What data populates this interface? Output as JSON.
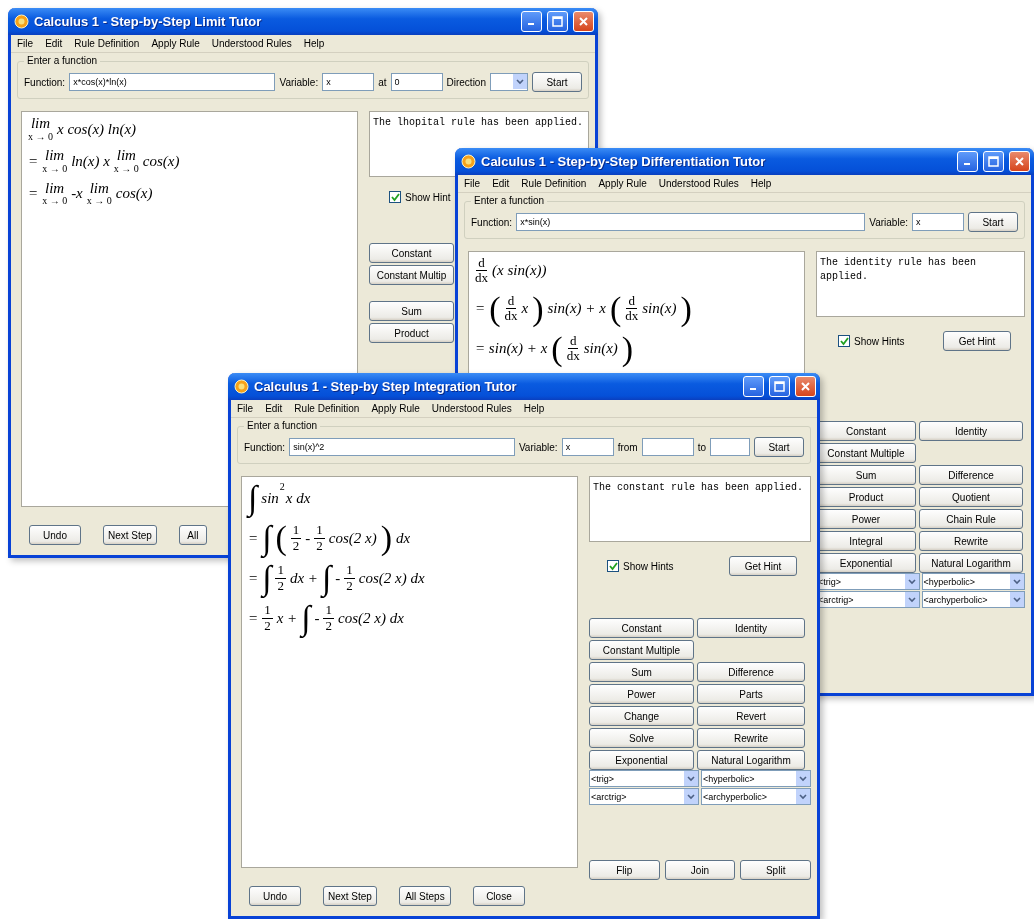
{
  "windows": [
    {
      "title": "Calculus 1 - Step-by-Step Limit Tutor",
      "menu": [
        "File",
        "Edit",
        "Rule Definition",
        "Apply Rule",
        "Understood Rules",
        "Help"
      ],
      "group_label": "Enter a function",
      "fields": [
        {
          "label": "Function:",
          "value": "x*cos(x)*ln(x)",
          "kind": "text"
        },
        {
          "label": "Variable:",
          "value": "x",
          "kind": "text"
        },
        {
          "label": "at",
          "value": "0",
          "kind": "text"
        },
        {
          "label": "Direction",
          "kind": "select"
        }
      ],
      "start": "Start",
      "math": [
        [
          {
            "kind": "lim",
            "word": "lim",
            "under": "x → 0"
          },
          {
            "kind": "text",
            "text": "x cos(x) ln(x)"
          }
        ],
        [
          {
            "kind": "text",
            "text": "="
          },
          {
            "kind": "lim",
            "word": "lim",
            "under": "x → 0"
          },
          {
            "kind": "text",
            "text": "ln(x) x"
          },
          {
            "kind": "lim",
            "word": "lim",
            "under": "x → 0"
          },
          {
            "kind": "text",
            "text": "cos(x)"
          }
        ],
        [
          {
            "kind": "text",
            "text": "="
          },
          {
            "kind": "lim",
            "word": "lim",
            "under": "x → 0"
          },
          {
            "kind": "text",
            "text": "-x"
          },
          {
            "kind": "lim",
            "word": "lim",
            "under": "x → 0"
          },
          {
            "kind": "text",
            "text": "cos(x)"
          }
        ]
      ],
      "hint": "The lhopital rule has been applied.",
      "show_hints": {
        "label": "Show Hint",
        "checked": true
      },
      "rule_groups": [
        [
          [
            "Constant"
          ],
          [
            "Constant Multip"
          ]
        ],
        [
          [
            "Sum"
          ],
          [
            "Product"
          ]
        ]
      ],
      "bottom_buttons": [
        "Undo",
        "Next Step",
        "All"
      ]
    },
    {
      "title": "Calculus 1 - Step-by-Step Differentiation Tutor",
      "menu": [
        "File",
        "Edit",
        "Rule Definition",
        "Apply Rule",
        "Understood Rules",
        "Help"
      ],
      "group_label": "Enter a function",
      "fields": [
        {
          "label": "Function:",
          "value": "x*sin(x)",
          "kind": "text"
        },
        {
          "label": "Variable:",
          "value": "x",
          "kind": "text"
        }
      ],
      "start": "Start",
      "math": [
        [
          {
            "kind": "frac",
            "num": "d",
            "den": "dx"
          },
          {
            "kind": "text",
            "text": "(x sin(x))"
          }
        ],
        [
          {
            "kind": "text",
            "text": "="
          },
          {
            "kind": "big",
            "text": "("
          },
          {
            "kind": "frac",
            "num": "d",
            "den": "dx"
          },
          {
            "kind": "text",
            "text": "x"
          },
          {
            "kind": "big",
            "text": ")"
          },
          {
            "kind": "text",
            "text": "sin(x) + x"
          },
          {
            "kind": "big",
            "text": "("
          },
          {
            "kind": "frac",
            "num": "d",
            "den": "dx"
          },
          {
            "kind": "text",
            "text": "sin(x)"
          },
          {
            "kind": "big",
            "text": ")"
          }
        ],
        [
          {
            "kind": "text",
            "text": "= sin(x) + x"
          },
          {
            "kind": "big",
            "text": "("
          },
          {
            "kind": "frac",
            "num": "d",
            "den": "dx"
          },
          {
            "kind": "text",
            "text": "sin(x)"
          },
          {
            "kind": "big",
            "text": ")"
          }
        ]
      ],
      "hint": "The identity rule has been applied.",
      "show_hints": {
        "label": "Show Hints",
        "checked": true
      },
      "get_hint": "Get Hint",
      "rule_groups": [
        [
          [
            "Constant",
            "Identity"
          ],
          [
            "Constant Multiple"
          ],
          [
            "Sum",
            "Difference"
          ],
          [
            "Product",
            "Quotient"
          ],
          [
            "Power",
            "Chain Rule"
          ],
          [
            "Integral",
            "Rewrite"
          ],
          [
            "Exponential",
            "Natural Logarithm"
          ]
        ]
      ],
      "dropdowns": [
        [
          "<trig>",
          "<hyperbolic>"
        ],
        [
          "<arctrig>",
          "<archyperbolic>"
        ]
      ]
    },
    {
      "title": "Calculus 1 - Step-by Step Integration Tutor",
      "menu": [
        "File",
        "Edit",
        "Rule Definition",
        "Apply Rule",
        "Understood Rules",
        "Help"
      ],
      "group_label": "Enter a function",
      "fields": [
        {
          "label": "Function:",
          "value": "sin(x)^2",
          "kind": "text"
        },
        {
          "label": "Variable:",
          "value": "x",
          "kind": "text"
        },
        {
          "label": "from",
          "kind": "text"
        },
        {
          "label": "to",
          "kind": "text"
        }
      ],
      "start": "Start",
      "math": [
        [
          {
            "kind": "big",
            "text": "∫"
          },
          {
            "kind": "text",
            "text": "sin"
          },
          {
            "kind": "sup",
            "text": "2"
          },
          {
            "kind": "text",
            "text": "x dx"
          }
        ],
        [
          {
            "kind": "text",
            "text": "="
          },
          {
            "kind": "big",
            "text": "∫"
          },
          {
            "kind": "big",
            "text": "("
          },
          {
            "kind": "frac",
            "num": "1",
            "den": "2"
          },
          {
            "kind": "text",
            "text": "-"
          },
          {
            "kind": "frac",
            "num": "1",
            "den": "2"
          },
          {
            "kind": "text",
            "text": "cos(2 x)"
          },
          {
            "kind": "big",
            "text": ")"
          },
          {
            "kind": "text",
            "text": "dx"
          }
        ],
        [
          {
            "kind": "text",
            "text": "="
          },
          {
            "kind": "big",
            "text": "∫"
          },
          {
            "kind": "frac",
            "num": "1",
            "den": "2"
          },
          {
            "kind": "text",
            "text": "dx +"
          },
          {
            "kind": "big",
            "text": "∫"
          },
          {
            "kind": "text",
            "text": "-"
          },
          {
            "kind": "frac",
            "num": "1",
            "den": "2"
          },
          {
            "kind": "text",
            "text": "cos(2 x) dx"
          }
        ],
        [
          {
            "kind": "text",
            "text": "="
          },
          {
            "kind": "frac",
            "num": "1",
            "den": "2"
          },
          {
            "kind": "text",
            "text": "x +"
          },
          {
            "kind": "big",
            "text": "∫"
          },
          {
            "kind": "text",
            "text": "-"
          },
          {
            "kind": "frac",
            "num": "1",
            "den": "2"
          },
          {
            "kind": "text",
            "text": "cos(2 x) dx"
          }
        ]
      ],
      "hint": "The constant rule has been applied.",
      "show_hints": {
        "label": "Show Hints",
        "checked": true
      },
      "get_hint": "Get Hint",
      "rule_groups": [
        [
          [
            "Constant",
            "Identity"
          ],
          [
            "Constant Multiple"
          ],
          [
            "Sum",
            "Difference"
          ],
          [
            "Power",
            "Parts"
          ],
          [
            "Change",
            "Revert"
          ],
          [
            "Solve",
            "Rewrite"
          ],
          [
            "Exponential",
            "Natural Logarithm"
          ]
        ]
      ],
      "dropdowns": [
        [
          "<trig>",
          "<hyperbolic>"
        ],
        [
          "<arctrig>",
          "<archyperbolic>"
        ]
      ],
      "extra_buttons": [
        "Flip",
        "Join",
        "Split"
      ],
      "bottom_buttons": [
        "Undo",
        "Next Step",
        "All Steps",
        "Close"
      ]
    }
  ]
}
